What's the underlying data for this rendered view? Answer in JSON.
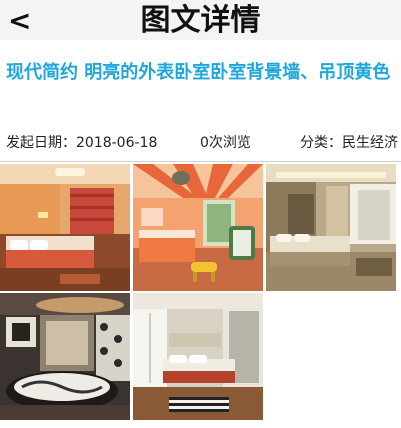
{
  "header": {
    "back_label": "<",
    "title": "图文详情"
  },
  "article": {
    "title": "现代简约 明亮的外表卧室卧室背景墙、吊顶黄色",
    "publish_date": "发起日期：2018-06-18",
    "views": "0次浏览",
    "category": "分类：民生经济"
  },
  "gallery": {
    "photos": [
      {
        "icon": "bedroom-photo-orange-curtains"
      },
      {
        "icon": "bedroom-photo-striped-ceiling"
      },
      {
        "icon": "bedroom-photo-beige-canopy"
      },
      {
        "icon": "bedroom-photo-round-bed"
      },
      {
        "icon": "bedroom-photo-white-wardrobe"
      }
    ]
  },
  "colors": {
    "title_accent": "#1ea7db",
    "topbar_bg": "#f4f4f4"
  }
}
